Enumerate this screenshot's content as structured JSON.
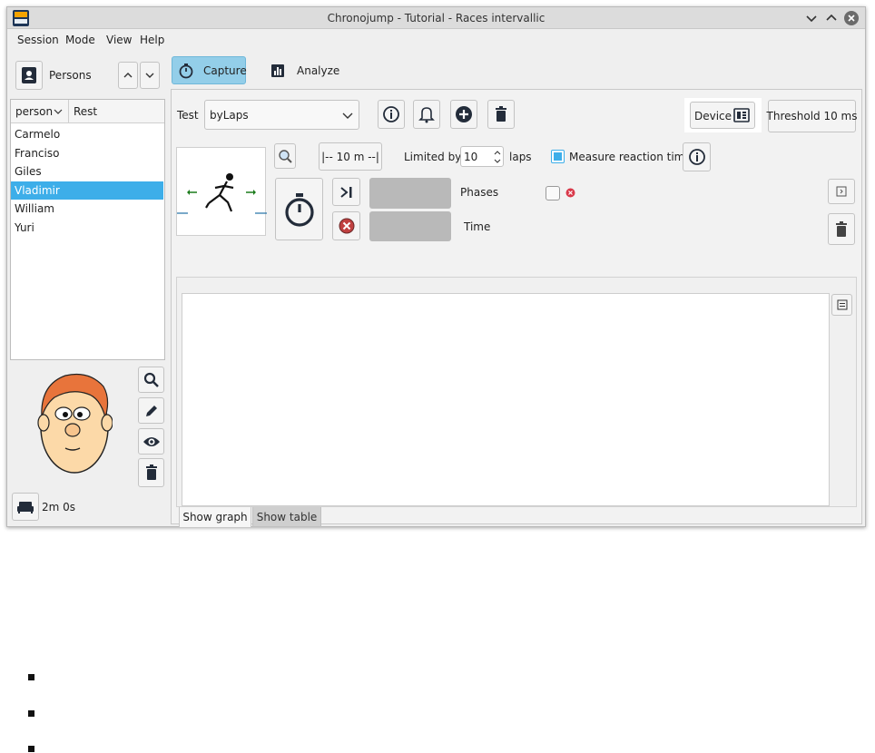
{
  "window": {
    "title": "Chronojump - Tutorial - Races intervallic"
  },
  "menu": [
    "Session",
    "Mode",
    "View",
    "Help"
  ],
  "persons": {
    "label": "Persons",
    "columns": [
      "person",
      "Rest"
    ],
    "rows": [
      "Carmelo",
      "Franciso",
      "Giles",
      "Vladimir",
      "William",
      "Yuri"
    ],
    "selected_index": 3,
    "rest_time": "2m 0s"
  },
  "tabs": {
    "capture": "Capture",
    "analyze": "Analyze"
  },
  "test": {
    "label": "Test",
    "selected": "byLaps",
    "device_label": "Device",
    "threshold_label": "Threshold 10 ms",
    "distance_label": "|-- 10 m --|",
    "limited_by_label": "Limited by",
    "limit_value": "10",
    "limit_unit": "laps",
    "reaction_label": "Measure reaction time",
    "reaction_checked": true,
    "phases_label": "Phases",
    "time_label": "Time"
  },
  "results": {
    "show_graph": "Show graph",
    "show_table": "Show table"
  },
  "colors": {
    "accent": "#3daee9",
    "selected_tab": "#93cee9",
    "dark_icon": "#232c3a"
  }
}
